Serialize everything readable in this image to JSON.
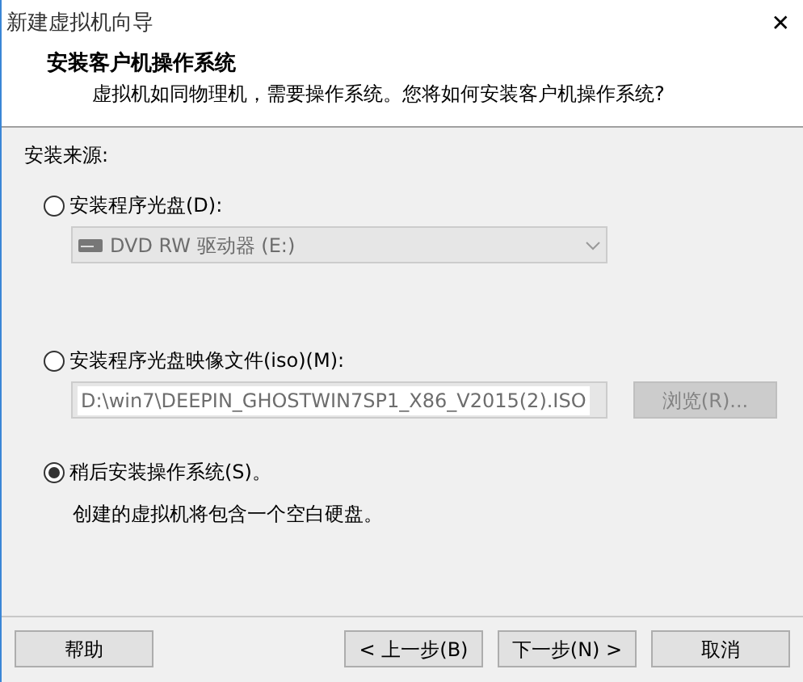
{
  "window": {
    "title": "新建虚拟机向导",
    "close": "✕"
  },
  "header": {
    "title": "安装客户机操作系统",
    "subtitle": "虚拟机如同物理机，需要操作系统。您将如何安装客户机操作系统?"
  },
  "source_label": "安装来源:",
  "options": [
    {
      "kind": "disc",
      "label": "安装程序光盘(D):",
      "selected": false,
      "combo": {
        "value": "DVD RW 驱动器 (E:)",
        "disabled": true
      }
    },
    {
      "kind": "iso",
      "label": "安装程序光盘映像文件(iso)(M):",
      "selected": false,
      "combo": {
        "value": "D:\\win7\\DEEPIN_GHOSTWIN7SP1_X86_V2015(2).ISO",
        "disabled": true
      },
      "browse": {
        "label": "浏览(R)...",
        "disabled": true
      }
    },
    {
      "kind": "later",
      "label": "稍后安装操作系统(S)。",
      "selected": true,
      "note": "创建的虚拟机将包含一个空白硬盘。"
    }
  ],
  "buttons": [
    {
      "label": "帮助",
      "disabled": false
    },
    {
      "label": "< 上一步(B)",
      "disabled": false
    },
    {
      "label": "下一步(N) >",
      "disabled": false
    },
    {
      "label": "取消",
      "disabled": false
    }
  ]
}
